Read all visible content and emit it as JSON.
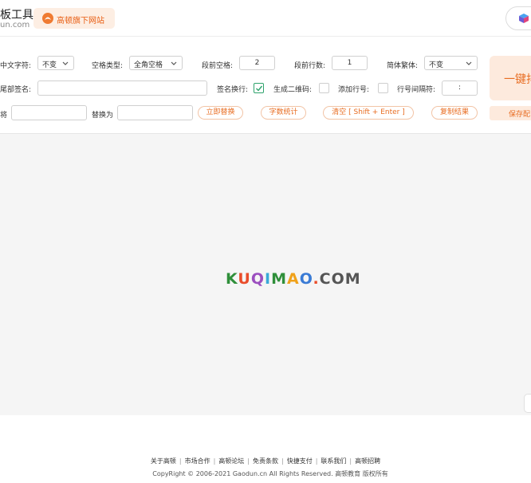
{
  "header": {
    "site_title": "板工具",
    "site_domain": "un.com",
    "badge_label": "高顿旗下网站"
  },
  "toolbar": {
    "chinese_char_label": "中文字符:",
    "chinese_char_value": "不变",
    "space_type_label": "空格类型:",
    "space_type_value": "全角空格",
    "para_space_label": "段前空格:",
    "para_space_value": "2",
    "para_lines_label": "段前行数:",
    "para_lines_value": "1",
    "trad_simp_label": "简体繁体:",
    "trad_simp_value": "不变",
    "signature_label": "尾部签名:",
    "signature_value": "",
    "sign_newline_label": "签名换行:",
    "qr_label": "生成二维码:",
    "line_no_label": "添加行号:",
    "line_sep_label": "行号间隔符:",
    "line_sep_value": ":",
    "replace_from_label": "将",
    "replace_to_label": "替换为",
    "replace_btn": "立即替换",
    "count_btn": "字数统计",
    "clear_btn": "清空 [ Shift + Enter ]",
    "copy_btn": "复制结果",
    "one_click_btn": "一键排",
    "save_btn": "保存配"
  },
  "main": {
    "watermark": [
      "K",
      "U",
      "Q",
      "I",
      "M",
      "A",
      "O",
      ".",
      "C",
      "O",
      "M"
    ],
    "watermark_colors": [
      "#2f8f3a",
      "#e94d2b",
      "#9b4fbf",
      "#3aa9d8",
      "#2f8f3a",
      "#f0a21b",
      "#3a7bd5",
      "#e94d2b",
      "#555555",
      "#555555",
      "#555555"
    ]
  },
  "footer": {
    "links": [
      "关于高顿",
      "市场合作",
      "高顿论坛",
      "免责条款",
      "快捷支付",
      "联系我们",
      "高顿招聘"
    ],
    "copyright": "CopyRight © 2006-2021 Gaodun.cn All Rights Reserved. 高顿教育 版权所有"
  },
  "colors": {
    "accent": "#e86d22",
    "accent_bg": "#fdeadd",
    "check": "#2ea36c"
  }
}
